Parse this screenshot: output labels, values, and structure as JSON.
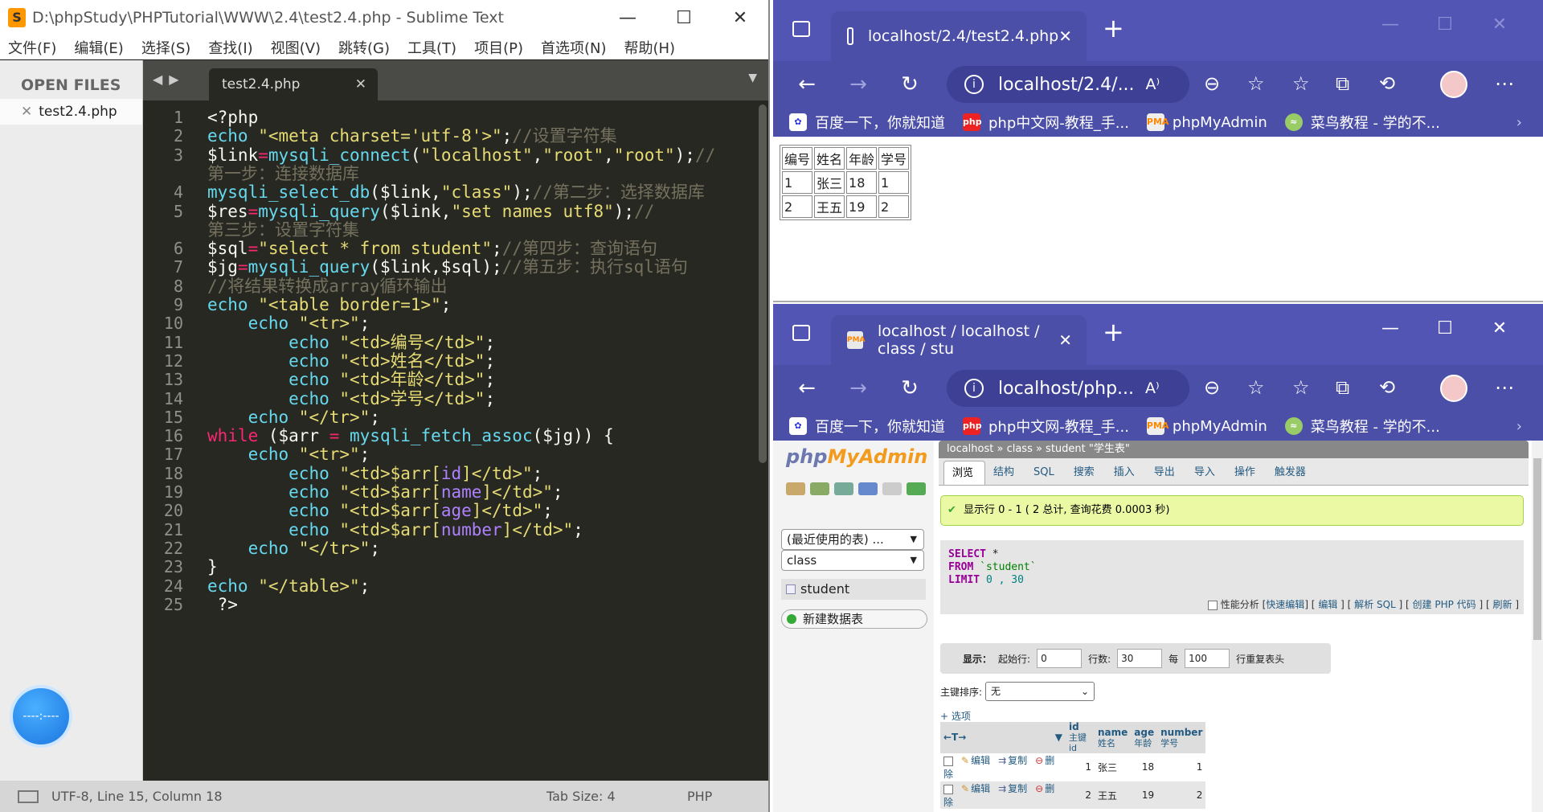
{
  "sublime": {
    "title": "D:\\phpStudy\\PHPTutorial\\WWW\\2.4\\test2.4.php - Sublime Text",
    "logo": "S",
    "menu": [
      "文件(F)",
      "编辑(E)",
      "选择(S)",
      "查找(I)",
      "视图(V)",
      "跳转(G)",
      "工具(T)",
      "项目(P)",
      "首选项(N)",
      "帮助(H)"
    ],
    "sidebar_header": "OPEN FILES",
    "sidebar_file": "test2.4.php",
    "tab_name": "test2.4.php",
    "status": {
      "encoding_pos": "UTF-8, Line 15, Column 18",
      "tab_size": "Tab Size: 4",
      "syntax": "PHP"
    },
    "current_line": 15,
    "float_button": "----:----"
  },
  "code_lines": [
    {
      "n": "1",
      "segs": [
        [
          "w",
          "<?php"
        ]
      ]
    },
    {
      "n": "2",
      "segs": [
        [
          "k",
          "echo "
        ],
        [
          "s",
          "\"<meta charset='utf-8'>\""
        ],
        [
          "w",
          ";"
        ],
        [
          "c",
          "//设置字符集"
        ]
      ]
    },
    {
      "n": "3",
      "segs": [
        [
          "w",
          "$link"
        ],
        [
          "p",
          "="
        ],
        [
          "k",
          "mysqli_connect"
        ],
        [
          "w",
          "("
        ],
        [
          "s",
          "\"localhost\""
        ],
        [
          "w",
          ","
        ],
        [
          "s",
          "\"root\""
        ],
        [
          "w",
          ","
        ],
        [
          "s",
          "\"root\""
        ],
        [
          "w",
          ");"
        ],
        [
          "c",
          "//"
        ]
      ]
    },
    {
      "n": "",
      "segs": [
        [
          "c",
          "第一步：连接数据库"
        ]
      ]
    },
    {
      "n": "4",
      "segs": [
        [
          "k",
          "mysqli_select_db"
        ],
        [
          "w",
          "($link,"
        ],
        [
          "s",
          "\"class\""
        ],
        [
          "w",
          ");"
        ],
        [
          "c",
          "//第二步：选择数据库"
        ]
      ]
    },
    {
      "n": "5",
      "segs": [
        [
          "w",
          "$res"
        ],
        [
          "p",
          "="
        ],
        [
          "k",
          "mysqli_query"
        ],
        [
          "w",
          "($link,"
        ],
        [
          "s",
          "\"set names utf8\""
        ],
        [
          "w",
          ");"
        ],
        [
          "c",
          "//"
        ]
      ]
    },
    {
      "n": "",
      "segs": [
        [
          "c",
          "第三步：设置字符集"
        ]
      ]
    },
    {
      "n": "6",
      "segs": [
        [
          "w",
          "$sql"
        ],
        [
          "p",
          "="
        ],
        [
          "s",
          "\"select * from student\""
        ],
        [
          "w",
          ";"
        ],
        [
          "c",
          "//第四步：查询语句"
        ]
      ]
    },
    {
      "n": "7",
      "segs": [
        [
          "w",
          "$jg"
        ],
        [
          "p",
          "="
        ],
        [
          "k",
          "mysqli_query"
        ],
        [
          "w",
          "($link,$sql);"
        ],
        [
          "c",
          "//第五步：执行sql语句"
        ]
      ]
    },
    {
      "n": "8",
      "segs": [
        [
          "c",
          "//将结果转换成array循环输出"
        ]
      ]
    },
    {
      "n": "9",
      "segs": [
        [
          "k",
          "echo "
        ],
        [
          "s",
          "\"<table border=1>\""
        ],
        [
          "w",
          ";"
        ]
      ]
    },
    {
      "n": "10",
      "segs": [
        [
          "w",
          "    "
        ],
        [
          "k",
          "echo "
        ],
        [
          "s",
          "\"<tr>\""
        ],
        [
          "w",
          ";"
        ]
      ]
    },
    {
      "n": "11",
      "segs": [
        [
          "w",
          "        "
        ],
        [
          "k",
          "echo "
        ],
        [
          "s",
          "\"<td>编号</td>\""
        ],
        [
          "w",
          ";"
        ]
      ]
    },
    {
      "n": "12",
      "segs": [
        [
          "w",
          "        "
        ],
        [
          "k",
          "echo "
        ],
        [
          "s",
          "\"<td>姓名</td>\""
        ],
        [
          "w",
          ";"
        ]
      ]
    },
    {
      "n": "13",
      "segs": [
        [
          "w",
          "        "
        ],
        [
          "k",
          "echo "
        ],
        [
          "s",
          "\"<td>年龄</td>\""
        ],
        [
          "w",
          ";"
        ]
      ]
    },
    {
      "n": "14",
      "segs": [
        [
          "w",
          "        "
        ],
        [
          "k",
          "echo "
        ],
        [
          "s",
          "\"<td>学号</td>\""
        ],
        [
          "w",
          ";"
        ]
      ]
    },
    {
      "n": "15",
      "segs": [
        [
          "w",
          "    "
        ],
        [
          "k",
          "echo "
        ],
        [
          "s",
          "\"</tr>\""
        ],
        [
          "w",
          ";"
        ]
      ]
    },
    {
      "n": "16",
      "segs": [
        [
          "p",
          "while "
        ],
        [
          "w",
          "($arr "
        ],
        [
          "p",
          "= "
        ],
        [
          "k",
          "mysqli_fetch_assoc"
        ],
        [
          "w",
          "($jg)) {"
        ]
      ]
    },
    {
      "n": "17",
      "segs": [
        [
          "w",
          "    "
        ],
        [
          "k",
          "echo "
        ],
        [
          "s",
          "\"<tr>\""
        ],
        [
          "w",
          ";"
        ]
      ]
    },
    {
      "n": "18",
      "segs": [
        [
          "w",
          "        "
        ],
        [
          "k",
          "echo "
        ],
        [
          "s",
          "\"<td>$arr["
        ],
        [
          "v",
          "id"
        ],
        [
          "s",
          "]</td>\""
        ],
        [
          "w",
          ";"
        ]
      ]
    },
    {
      "n": "19",
      "segs": [
        [
          "w",
          "        "
        ],
        [
          "k",
          "echo "
        ],
        [
          "s",
          "\"<td>$arr["
        ],
        [
          "v",
          "name"
        ],
        [
          "s",
          "]</td>\""
        ],
        [
          "w",
          ";"
        ]
      ]
    },
    {
      "n": "20",
      "segs": [
        [
          "w",
          "        "
        ],
        [
          "k",
          "echo "
        ],
        [
          "s",
          "\"<td>$arr["
        ],
        [
          "v",
          "age"
        ],
        [
          "s",
          "]</td>\""
        ],
        [
          "w",
          ";"
        ]
      ]
    },
    {
      "n": "21",
      "segs": [
        [
          "w",
          "        "
        ],
        [
          "k",
          "echo "
        ],
        [
          "s",
          "\"<td>$arr["
        ],
        [
          "v",
          "number"
        ],
        [
          "s",
          "]</td>\""
        ],
        [
          "w",
          ";"
        ]
      ]
    },
    {
      "n": "22",
      "segs": [
        [
          "w",
          "    "
        ],
        [
          "k",
          "echo "
        ],
        [
          "s",
          "\"</tr>\""
        ],
        [
          "w",
          ";"
        ]
      ]
    },
    {
      "n": "23",
      "segs": [
        [
          "w",
          "}"
        ]
      ]
    },
    {
      "n": "24",
      "segs": [
        [
          "k",
          "echo "
        ],
        [
          "s",
          "\"</table>\""
        ],
        [
          "w",
          ";"
        ]
      ]
    },
    {
      "n": "25",
      "segs": [
        [
          "w",
          " ?>"
        ]
      ]
    }
  ],
  "browser_top": {
    "tab_title": "localhost/2.4/test2.4.php",
    "url": "localhost/2.4/...",
    "bookmarks": [
      "百度一下，你就知道",
      "php中文网-教程_手...",
      "phpMyAdmin",
      "菜鸟教程 - 学的不..."
    ],
    "table": [
      [
        "编号",
        "姓名",
        "年龄",
        "学号"
      ],
      [
        "1",
        "张三",
        "18",
        "1"
      ],
      [
        "2",
        "王五",
        "19",
        "2"
      ]
    ]
  },
  "browser_bottom": {
    "tab_title": "localhost / localhost / class / stu",
    "url": "localhost/php...",
    "bookmarks": [
      "百度一下，你就知道",
      "php中文网-教程_手...",
      "phpMyAdmin",
      "菜鸟教程 - 学的不..."
    ],
    "pma": {
      "logo_php": "php",
      "logo_my": "MyAdmin",
      "recent_select": "(最近使用的表) ...",
      "db_select": "class",
      "table_item": "student",
      "new_table": "新建数据表",
      "breadcrumb": "localhost » class » student \"学生表\"",
      "tabs": [
        "浏览",
        "结构",
        "SQL",
        "搜索",
        "插入",
        "导出",
        "导入",
        "操作",
        "触发器"
      ],
      "success": "显示行 0 - 1 ( 2 总计, 查询花费 0.0003 秒)",
      "sql": {
        "select": "SELECT",
        "star": " *",
        "from": "FROM",
        "table": " `student`",
        "limit": "LIMIT",
        "nums": " 0 , 30"
      },
      "links_prefix": "性能分析",
      "links": [
        "快速编辑",
        "编辑",
        "解析 SQL",
        "创建 PHP 代码",
        "刷新"
      ],
      "nav": {
        "show": "显示：",
        "start_label": "起始行:",
        "start": "0",
        "rows_label": "行数:",
        "rows": "30",
        "every": "每",
        "every_val": "100",
        "repeat": "行重复表头"
      },
      "sort_label": "主键排序:",
      "sort_value": "无",
      "options": "+ 选项",
      "columns": [
        {
          "name": "id",
          "comment": "主键id"
        },
        {
          "name": "name",
          "comment": "姓名"
        },
        {
          "name": "age",
          "comment": "年龄"
        },
        {
          "name": "number",
          "comment": "学号"
        }
      ],
      "row_actions": [
        "编辑",
        "复制",
        "删除"
      ],
      "rows": [
        [
          "1",
          "张三",
          "18",
          "1"
        ],
        [
          "2",
          "王五",
          "19",
          "2"
        ]
      ]
    }
  },
  "colors": {
    "browser_accent": "#4b4fa8",
    "sublime_bg": "#272822",
    "pma_success": "#ebf8a4"
  }
}
